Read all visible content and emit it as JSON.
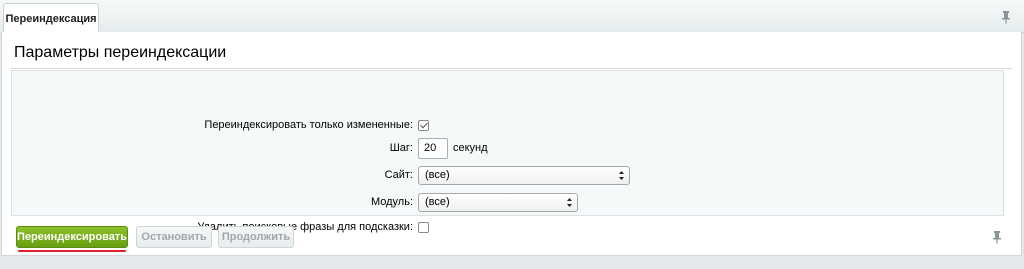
{
  "tabs": [
    {
      "label": "Переиндексация",
      "active": true
    }
  ],
  "panel": {
    "title": "Параметры переиндексации"
  },
  "form": {
    "only_changed": {
      "label": "Переиндексировать только измененные:",
      "checked": true
    },
    "step": {
      "label": "Шаг:",
      "value": "20",
      "unit": "секунд"
    },
    "site": {
      "label": "Сайт:",
      "selected": "(все)"
    },
    "module": {
      "label": "Модуль:",
      "selected": "(все)"
    },
    "delete_phrases": {
      "label": "Удалить поисковые фразы для подсказки:",
      "checked": false
    }
  },
  "buttons": {
    "reindex": "Переиндексировать",
    "stop": "Остановить",
    "continue": "Продолжить"
  },
  "colors": {
    "primary_button": "#7bb11d",
    "annotation_underline": "#e0242b"
  },
  "icons": [
    "pin-icon",
    "checkmark-icon",
    "select-arrows-icon"
  ]
}
